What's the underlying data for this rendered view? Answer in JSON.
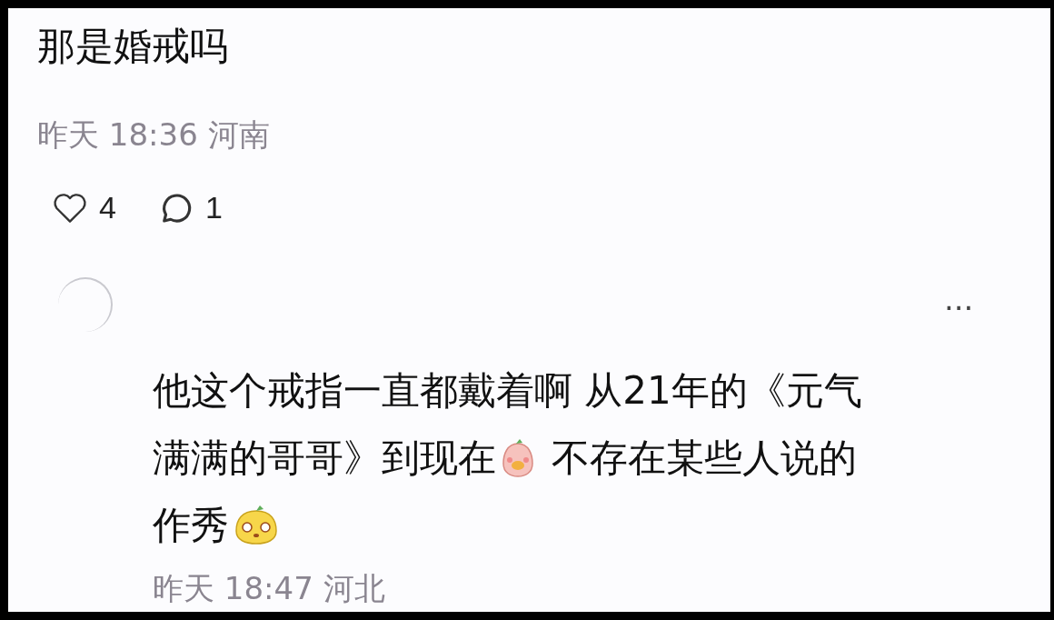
{
  "comment": {
    "text": "那是婚戒吗",
    "meta": "昨天 18:36 河南",
    "likes": "4",
    "replies": "1"
  },
  "reply": {
    "body": [
      {
        "kind": "text",
        "text": "他这个戒指一直都戴着啊 从21年的《元气满满的哥哥》到现在"
      },
      {
        "kind": "pink-sticker"
      },
      {
        "kind": "text",
        "text": " 不存在某些人说的作秀"
      },
      {
        "kind": "yellow-sticker"
      }
    ],
    "meta": "昨天 18:47 河北",
    "menu": "···"
  }
}
